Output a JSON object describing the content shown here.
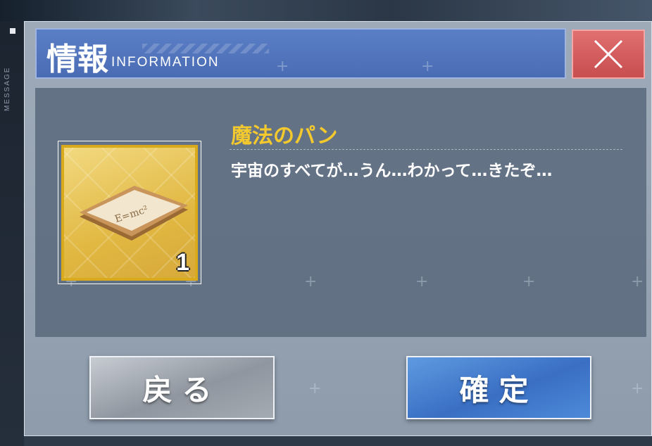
{
  "side": {
    "label": "MESSAGE"
  },
  "header": {
    "title_jp": "情報",
    "title_en": "INFORMATION",
    "close_icon": "close-icon",
    "close_color": "#d85a5c",
    "header_color": "#5074be"
  },
  "item": {
    "name": "魔法のパン",
    "count": "1",
    "description": "宇宙のすべてが…うん…わかって…きたぞ…",
    "icon": "magic-bread-icon",
    "name_color": "#f3c92e"
  },
  "buttons": {
    "back_label": "戻る",
    "confirm_label": "確定",
    "confirm_color": "#3f78cc"
  }
}
